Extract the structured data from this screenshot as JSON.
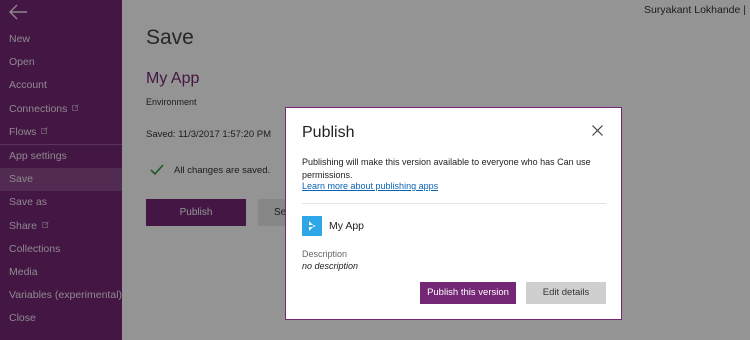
{
  "header": {
    "user_name": "Suryakant Lokhande | "
  },
  "sidebar": {
    "items": [
      {
        "label": "New"
      },
      {
        "label": "Open"
      },
      {
        "label": "Account"
      },
      {
        "label": "Connections"
      },
      {
        "label": "Flows"
      },
      {
        "label": "App settings"
      },
      {
        "label": "Save"
      },
      {
        "label": "Save as"
      },
      {
        "label": "Share"
      },
      {
        "label": "Collections"
      },
      {
        "label": "Media"
      },
      {
        "label": "Variables (experimental)"
      },
      {
        "label": "Close"
      }
    ]
  },
  "main": {
    "page_title": "Save",
    "app_title": "My App",
    "environment_label": "Environment",
    "saved_label": "Saved: 11/3/2017 1:57:20 PM",
    "all_saved": "All changes are saved.",
    "publish_button": "Publish",
    "second_button": "Se"
  },
  "dialog": {
    "title": "Publish",
    "message": "Publishing will make this version available to everyone who has Can use permissions.",
    "link": "Learn more about publishing apps",
    "app_name": "My App",
    "description_label": "Description",
    "description_value": "no description",
    "publish_version_button": "Publish this version",
    "edit_details_button": "Edit details"
  },
  "colors": {
    "brand": "#742774",
    "link": "#0a63b3",
    "app_icon": "#2ea6e8",
    "check": "#2e9a3e"
  }
}
